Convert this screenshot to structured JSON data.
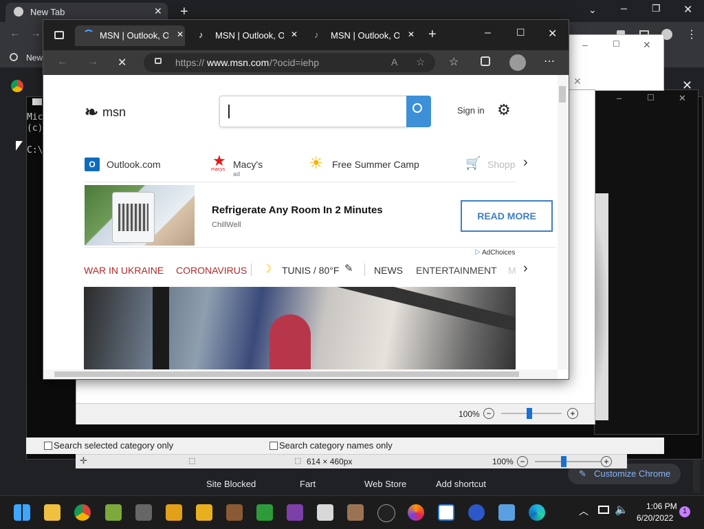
{
  "chrome": {
    "tab_title": "New Tab",
    "bookmark_label": "New",
    "shortcuts": [
      "Site Blocked",
      "Fart",
      "Web Store",
      "Add shortcut"
    ],
    "customize_label": "Customize Chrome"
  },
  "console": {
    "lines": [
      "Mic",
      "(c)",
      "",
      "C:\\"
    ]
  },
  "viewer": {
    "zoom_top": "100%",
    "zoom_bottom": "100%",
    "checkbox1": "Search selected category only",
    "checkbox2": "Search category names only",
    "dimensions": "614 × 460px"
  },
  "edge": {
    "tabs": [
      "MSN | Outlook, Off",
      "MSN | Outlook, Off",
      "MSN | Outlook, Off"
    ],
    "url_prefix": "https://",
    "url_domain": "www.msn.com",
    "url_suffix": "/?ocid=iehp"
  },
  "msn": {
    "logo": "msn",
    "sign_in": "Sign in",
    "quicklinks": [
      {
        "label": "Outlook.com",
        "sub": ""
      },
      {
        "label": "Macy's",
        "sub": "ad"
      },
      {
        "label": "Free Summer Camp",
        "sub": ""
      },
      {
        "label": "Shopp",
        "sub": ""
      }
    ],
    "macys_logo": "macys",
    "ad_title": "Refrigerate Any Room In 2 Minutes",
    "ad_source": "ChillWell",
    "ad_button": "READ MORE",
    "adchoices": "AdChoices",
    "nav": [
      "WAR IN UKRAINE",
      "CORONAVIRUS",
      "TUNIS / 80°F",
      "NEWS",
      "ENTERTAINMENT",
      "M"
    ]
  },
  "taskbar": {
    "time": "1:06 PM",
    "date": "6/20/2022",
    "notification_count": "1"
  },
  "colors": {
    "edge_accent": "#3d8fd8",
    "nav_red": "#b02a2a",
    "taskbar_bg": "#1c1c1c"
  }
}
